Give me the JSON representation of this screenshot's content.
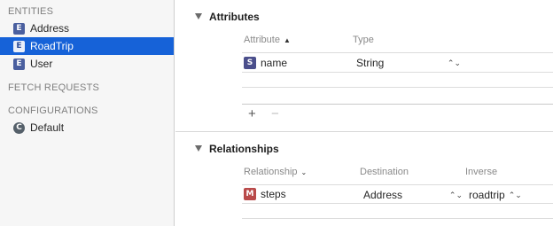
{
  "sidebar": {
    "entities_header": "ENTITIES",
    "entities": [
      {
        "badge": "E",
        "label": "Address"
      },
      {
        "badge": "E",
        "label": "RoadTrip"
      },
      {
        "badge": "E",
        "label": "User"
      }
    ],
    "fetch_header": "FETCH REQUESTS",
    "config_header": "CONFIGURATIONS",
    "configurations": [
      {
        "badge": "C",
        "label": "Default"
      }
    ]
  },
  "attributes": {
    "title": "Attributes",
    "col_attribute": "Attribute",
    "col_type": "Type",
    "rows": [
      {
        "badge": "S",
        "name": "name",
        "type": "String"
      }
    ],
    "add_label": "+",
    "remove_label": "−"
  },
  "relationships": {
    "title": "Relationships",
    "col_relationship": "Relationship",
    "col_destination": "Destination",
    "col_inverse": "Inverse",
    "rows": [
      {
        "badge": "M",
        "name": "steps",
        "destination": "Address",
        "inverse": "roadtrip"
      }
    ]
  },
  "icons": {
    "sort_ascending": "chevron-up-icon",
    "sort_descending": "chevron-down-icon",
    "stepper": "up-down-stepper-icon",
    "disclosure": "disclosure-triangle-icon"
  },
  "colors": {
    "selection": "#1662d8",
    "entity_badge": "#4a5f9f",
    "relationship_badge": "#b94a4a"
  }
}
